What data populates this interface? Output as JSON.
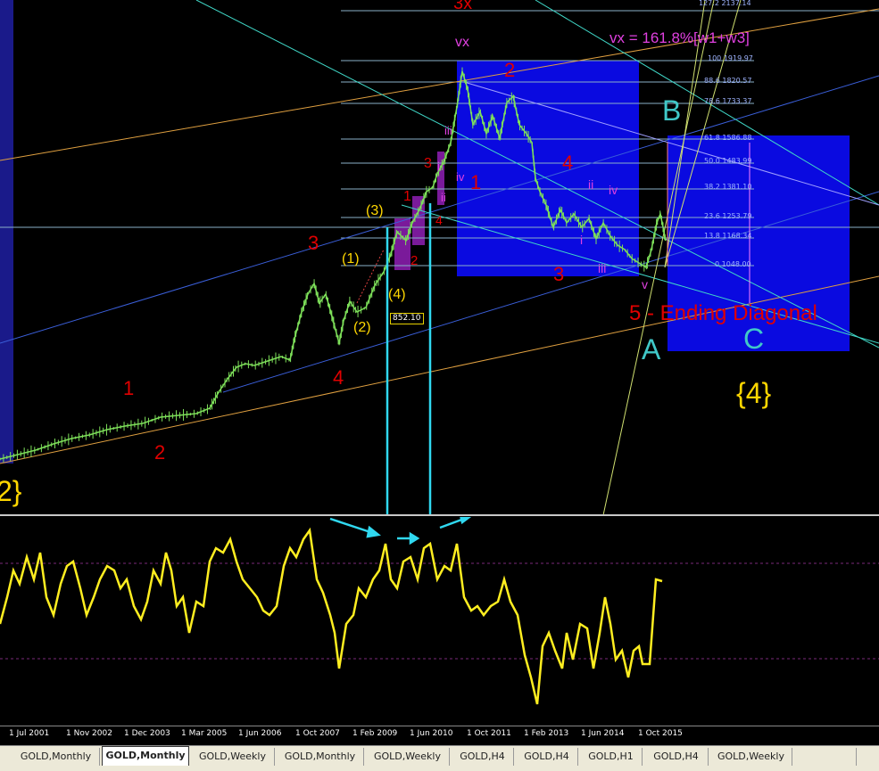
{
  "main_chart": {
    "wave_labels": [
      {
        "id": "3x",
        "text": "3x",
        "color": "#e00000"
      },
      {
        "id": "vx",
        "text": "vx",
        "color": "#e040e0"
      },
      {
        "id": "vx-note",
        "text": "vx = 161.8%[w1+w3]",
        "color": "#e040e0"
      },
      {
        "id": "red-2-top",
        "text": "2",
        "color": "#e00000"
      },
      {
        "id": "B",
        "text": "B",
        "color": "#40c8c8"
      },
      {
        "id": "iii-a",
        "text": "iii",
        "color": "#e040e0"
      },
      {
        "id": "3-small",
        "text": "3",
        "color": "#e00000"
      },
      {
        "id": "i-a",
        "text": "i",
        "color": "#e040e0"
      },
      {
        "id": "iv-a",
        "text": "iv",
        "color": "#e040e0"
      },
      {
        "id": "1-red",
        "text": "1",
        "color": "#e00000"
      },
      {
        "id": "ii-a",
        "text": "ii",
        "color": "#e040e0"
      },
      {
        "id": "4-red-top",
        "text": "4",
        "color": "#e00000"
      },
      {
        "id": "ii-b",
        "text": "ii",
        "color": "#e040e0"
      },
      {
        "id": "iv-b",
        "text": "iv",
        "color": "#e040e0"
      },
      {
        "id": "1-small",
        "text": "1",
        "color": "#e00000"
      },
      {
        "id": "4-small",
        "text": "4",
        "color": "#e00000"
      },
      {
        "id": "paren-3",
        "text": "(3)",
        "color": "#ffd700"
      },
      {
        "id": "3-red-left",
        "text": "3",
        "color": "#e00000"
      },
      {
        "id": "paren-1",
        "text": "(1)",
        "color": "#ffd700"
      },
      {
        "id": "2-small",
        "text": "2",
        "color": "#e00000"
      },
      {
        "id": "i-b",
        "text": "i",
        "color": "#e040e0"
      },
      {
        "id": "iii-b",
        "text": "iii",
        "color": "#e040e0"
      },
      {
        "id": "3-red-mid",
        "text": "3",
        "color": "#e00000"
      },
      {
        "id": "paren-4",
        "text": "(4)",
        "color": "#ffd700"
      },
      {
        "id": "v",
        "text": "v",
        "color": "#e040e0"
      },
      {
        "id": "paren-2",
        "text": "(2)",
        "color": "#ffd700"
      },
      {
        "id": "ending-diag",
        "text": "5 - Ending Diagonal",
        "color": "#e00000"
      },
      {
        "id": "C",
        "text": "C",
        "color": "#40c8c8"
      },
      {
        "id": "A",
        "text": "A",
        "color": "#40c8c8"
      },
      {
        "id": "4-red-low",
        "text": "4",
        "color": "#e00000"
      },
      {
        "id": "1-red-low",
        "text": "1",
        "color": "#e00000"
      },
      {
        "id": "brace-4",
        "text": "{4}",
        "color": "#ffd700"
      },
      {
        "id": "2-red-low",
        "text": "2",
        "color": "#e00000"
      },
      {
        "id": "brace-2",
        "text": "2}",
        "color": "#ffd700"
      }
    ],
    "fib_levels": [
      {
        "label": "127.2 2137.14"
      },
      {
        "label": "100 1919.97"
      },
      {
        "label": "88.6 1820.57"
      },
      {
        "label": "78.6 1733.37"
      },
      {
        "label": "61.8 1586.88"
      },
      {
        "label": "50.0 1483.99"
      },
      {
        "label": "38.2 1381.10"
      },
      {
        "label": "23.6 1253.79"
      },
      {
        "label": "13.8 1168.34"
      },
      {
        "label": "0 1048.00"
      }
    ],
    "price_marker": "852.10",
    "colors": {
      "rect_fill": "#0a0ae0",
      "candle": "#7ee05a",
      "fib_line": "#8ab0c8",
      "channel_blue": "#3a5ed8",
      "channel_orange": "#e0a040",
      "cyan_arrow": "#30d8f0",
      "osc_line": "#ffee20"
    }
  },
  "time_axis": [
    "1 Jul 2001",
    "1 Nov 2002",
    "1 Dec 2003",
    "1 Mar 2005",
    "1 Jun 2006",
    "1 Oct 2007",
    "1 Feb 2009",
    "1 Jun 2010",
    "1 Oct 2011",
    "1 Feb 2013",
    "1 Jun 2014",
    "1 Oct 2015"
  ],
  "tabs": [
    {
      "label": "GOLD,Monthly",
      "active": false
    },
    {
      "label": "GOLD,Monthly",
      "active": true
    },
    {
      "label": "GOLD,Weekly",
      "active": false
    },
    {
      "label": "GOLD,Monthly",
      "active": false
    },
    {
      "label": "GOLD,Weekly",
      "active": false
    },
    {
      "label": "GOLD,H4",
      "active": false
    },
    {
      "label": "GOLD,H4",
      "active": false
    },
    {
      "label": "GOLD,H1",
      "active": false
    },
    {
      "label": "GOLD,H4",
      "active": false
    },
    {
      "label": "GOLD,Weekly",
      "active": false
    },
    {
      "label": "",
      "active": false
    }
  ]
}
